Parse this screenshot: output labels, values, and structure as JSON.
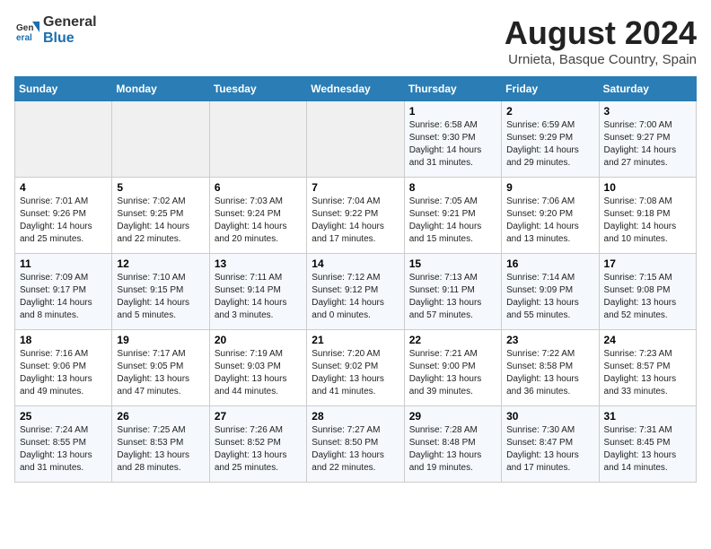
{
  "header": {
    "logo_general": "General",
    "logo_blue": "Blue",
    "title": "August 2024",
    "subtitle": "Urnieta, Basque Country, Spain"
  },
  "days_of_week": [
    "Sunday",
    "Monday",
    "Tuesday",
    "Wednesday",
    "Thursday",
    "Friday",
    "Saturday"
  ],
  "weeks": [
    [
      {
        "day": "",
        "info": ""
      },
      {
        "day": "",
        "info": ""
      },
      {
        "day": "",
        "info": ""
      },
      {
        "day": "",
        "info": ""
      },
      {
        "day": "1",
        "info": "Sunrise: 6:58 AM\nSunset: 9:30 PM\nDaylight: 14 hours\nand 31 minutes."
      },
      {
        "day": "2",
        "info": "Sunrise: 6:59 AM\nSunset: 9:29 PM\nDaylight: 14 hours\nand 29 minutes."
      },
      {
        "day": "3",
        "info": "Sunrise: 7:00 AM\nSunset: 9:27 PM\nDaylight: 14 hours\nand 27 minutes."
      }
    ],
    [
      {
        "day": "4",
        "info": "Sunrise: 7:01 AM\nSunset: 9:26 PM\nDaylight: 14 hours\nand 25 minutes."
      },
      {
        "day": "5",
        "info": "Sunrise: 7:02 AM\nSunset: 9:25 PM\nDaylight: 14 hours\nand 22 minutes."
      },
      {
        "day": "6",
        "info": "Sunrise: 7:03 AM\nSunset: 9:24 PM\nDaylight: 14 hours\nand 20 minutes."
      },
      {
        "day": "7",
        "info": "Sunrise: 7:04 AM\nSunset: 9:22 PM\nDaylight: 14 hours\nand 17 minutes."
      },
      {
        "day": "8",
        "info": "Sunrise: 7:05 AM\nSunset: 9:21 PM\nDaylight: 14 hours\nand 15 minutes."
      },
      {
        "day": "9",
        "info": "Sunrise: 7:06 AM\nSunset: 9:20 PM\nDaylight: 14 hours\nand 13 minutes."
      },
      {
        "day": "10",
        "info": "Sunrise: 7:08 AM\nSunset: 9:18 PM\nDaylight: 14 hours\nand 10 minutes."
      }
    ],
    [
      {
        "day": "11",
        "info": "Sunrise: 7:09 AM\nSunset: 9:17 PM\nDaylight: 14 hours\nand 8 minutes."
      },
      {
        "day": "12",
        "info": "Sunrise: 7:10 AM\nSunset: 9:15 PM\nDaylight: 14 hours\nand 5 minutes."
      },
      {
        "day": "13",
        "info": "Sunrise: 7:11 AM\nSunset: 9:14 PM\nDaylight: 14 hours\nand 3 minutes."
      },
      {
        "day": "14",
        "info": "Sunrise: 7:12 AM\nSunset: 9:12 PM\nDaylight: 14 hours\nand 0 minutes."
      },
      {
        "day": "15",
        "info": "Sunrise: 7:13 AM\nSunset: 9:11 PM\nDaylight: 13 hours\nand 57 minutes."
      },
      {
        "day": "16",
        "info": "Sunrise: 7:14 AM\nSunset: 9:09 PM\nDaylight: 13 hours\nand 55 minutes."
      },
      {
        "day": "17",
        "info": "Sunrise: 7:15 AM\nSunset: 9:08 PM\nDaylight: 13 hours\nand 52 minutes."
      }
    ],
    [
      {
        "day": "18",
        "info": "Sunrise: 7:16 AM\nSunset: 9:06 PM\nDaylight: 13 hours\nand 49 minutes."
      },
      {
        "day": "19",
        "info": "Sunrise: 7:17 AM\nSunset: 9:05 PM\nDaylight: 13 hours\nand 47 minutes."
      },
      {
        "day": "20",
        "info": "Sunrise: 7:19 AM\nSunset: 9:03 PM\nDaylight: 13 hours\nand 44 minutes."
      },
      {
        "day": "21",
        "info": "Sunrise: 7:20 AM\nSunset: 9:02 PM\nDaylight: 13 hours\nand 41 minutes."
      },
      {
        "day": "22",
        "info": "Sunrise: 7:21 AM\nSunset: 9:00 PM\nDaylight: 13 hours\nand 39 minutes."
      },
      {
        "day": "23",
        "info": "Sunrise: 7:22 AM\nSunset: 8:58 PM\nDaylight: 13 hours\nand 36 minutes."
      },
      {
        "day": "24",
        "info": "Sunrise: 7:23 AM\nSunset: 8:57 PM\nDaylight: 13 hours\nand 33 minutes."
      }
    ],
    [
      {
        "day": "25",
        "info": "Sunrise: 7:24 AM\nSunset: 8:55 PM\nDaylight: 13 hours\nand 31 minutes."
      },
      {
        "day": "26",
        "info": "Sunrise: 7:25 AM\nSunset: 8:53 PM\nDaylight: 13 hours\nand 28 minutes."
      },
      {
        "day": "27",
        "info": "Sunrise: 7:26 AM\nSunset: 8:52 PM\nDaylight: 13 hours\nand 25 minutes."
      },
      {
        "day": "28",
        "info": "Sunrise: 7:27 AM\nSunset: 8:50 PM\nDaylight: 13 hours\nand 22 minutes."
      },
      {
        "day": "29",
        "info": "Sunrise: 7:28 AM\nSunset: 8:48 PM\nDaylight: 13 hours\nand 19 minutes."
      },
      {
        "day": "30",
        "info": "Sunrise: 7:30 AM\nSunset: 8:47 PM\nDaylight: 13 hours\nand 17 minutes."
      },
      {
        "day": "31",
        "info": "Sunrise: 7:31 AM\nSunset: 8:45 PM\nDaylight: 13 hours\nand 14 minutes."
      }
    ]
  ]
}
